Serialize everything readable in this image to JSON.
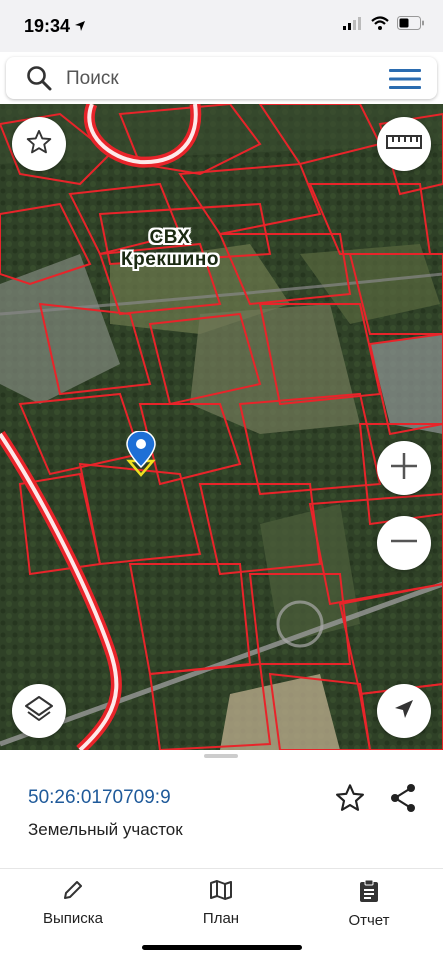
{
  "status_bar": {
    "time": "19:34",
    "icons": [
      "location-arrow-icon",
      "cellular-signal-icon",
      "wifi-icon",
      "battery-icon"
    ]
  },
  "search": {
    "placeholder": "Поиск",
    "icons": [
      "search-icon",
      "menu-icon"
    ]
  },
  "map": {
    "label": "СВХ\nКрекшино",
    "label_line1": "СВХ",
    "label_line2": "Крекшино",
    "buttons": [
      "star-icon",
      "ruler-icon",
      "zoom-in-icon",
      "zoom-out-icon",
      "layers-icon",
      "navigation-arrow-icon"
    ],
    "boundary_color": "#e8242a",
    "pin_color": "#1e6fd6"
  },
  "parcel": {
    "cadastral_number": "50:26:0170709:9",
    "type": "Земельный участок",
    "icons": [
      "star-outline-icon",
      "share-icon"
    ]
  },
  "tabs": [
    {
      "label": "Выписка",
      "icon": "pencil-icon"
    },
    {
      "label": "План",
      "icon": "map-icon"
    },
    {
      "label": "Отчет",
      "icon": "clipboard-icon"
    }
  ],
  "colors": {
    "accent": "#1f5a9a",
    "menu": "#2b6cb0"
  }
}
